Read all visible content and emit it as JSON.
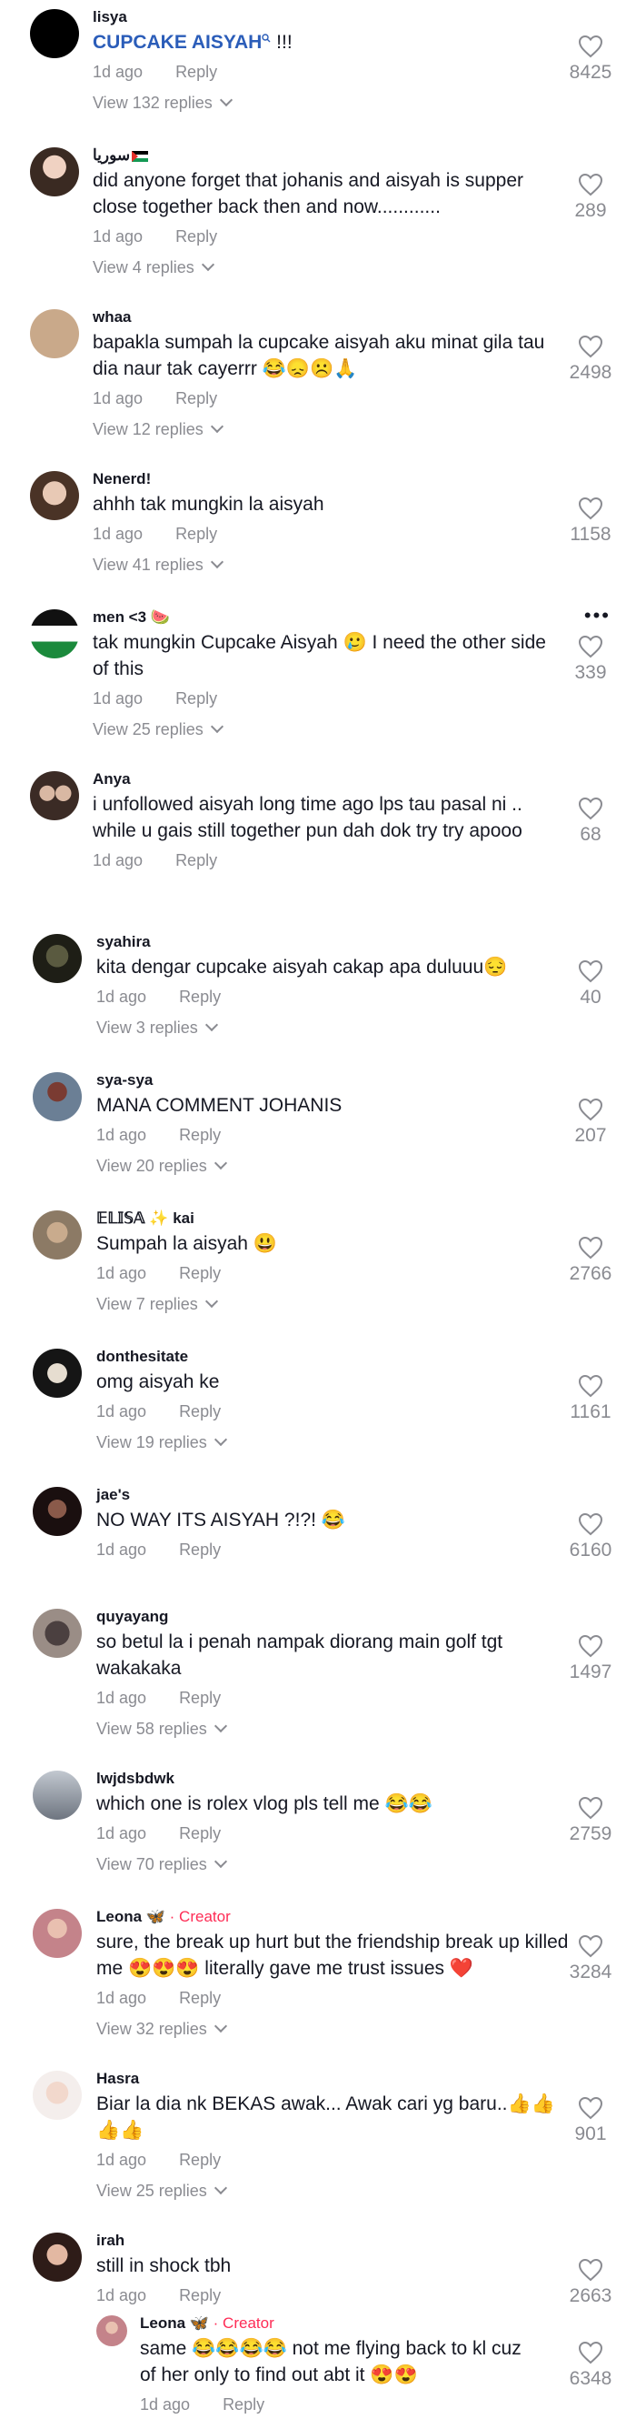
{
  "comments": [
    {
      "user": "lisya",
      "pre": "",
      "hl": "CUPCAKE AISYAH",
      "post": " !!!",
      "when": "1d ago",
      "reply": "Reply",
      "likes": "8425",
      "view": "View 132 replies"
    },
    {
      "user": "سوريا",
      "text": "did anyone forget that johanis and aisyah is supper close together back then and now............",
      "when": "1d ago",
      "reply": "Reply",
      "likes": "289",
      "view": "View 4 replies"
    },
    {
      "user": "whaa",
      "text": "bapakla sumpah la cupcake aisyah aku minat gila tau dia naur tak cayerrr 😂😞☹️🙏",
      "when": "1d ago",
      "reply": "Reply",
      "likes": "2498",
      "view": "View 12 replies"
    },
    {
      "user": "Nenerd!",
      "text": "ahhh tak mungkin la aisyah",
      "when": "1d ago",
      "reply": "Reply",
      "likes": "1158",
      "view": "View 41 replies"
    },
    {
      "user": "men <3 🍉",
      "text": "tak mungkin Cupcake Aisyah 🥲 I need the other side of this",
      "when": "1d ago",
      "reply": "Reply",
      "likes": "339",
      "view": "View 25 replies",
      "more": "•••"
    },
    {
      "user": "Anya",
      "text": "i unfollowed aisyah long time ago lps tau pasal ni .. while u gais still together pun dah dok try try apooo",
      "when": "1d ago",
      "reply": "Reply",
      "likes": "68",
      "view": ""
    },
    {
      "user": "syahira",
      "text": "kita dengar cupcake aisyah cakap apa duluuu😔",
      "when": "1d ago",
      "reply": "Reply",
      "likes": "40",
      "view": "View 3 replies"
    },
    {
      "user": "sya-sya",
      "text": "MANA COMMENT JOHANIS",
      "when": "1d ago",
      "reply": "Reply",
      "likes": "207",
      "view": "View 20 replies"
    },
    {
      "user": "𝔼𝕃𝕀𝕊𝔸 ✨ kai",
      "text": "Sumpah la aisyah 😃",
      "when": "1d ago",
      "reply": "Reply",
      "likes": "2766",
      "view": "View 7 replies"
    },
    {
      "user": "donthesitate",
      "text": "omg aisyah ke",
      "when": "1d ago",
      "reply": "Reply",
      "likes": "1161",
      "view": "View 19 replies"
    },
    {
      "user": "jae's",
      "text": "NO WAY ITS AISYAH ?!?! 😂",
      "when": "1d ago",
      "reply": "Reply",
      "likes": "6160",
      "view": ""
    },
    {
      "user": "quyayang",
      "text": "so betul la i penah nampak diorang main golf tgt wakakaka",
      "when": "1d ago",
      "reply": "Reply",
      "likes": "1497",
      "view": "View 58 replies"
    },
    {
      "user": "lwjdsbdwk",
      "text": "which one is rolex vlog pls tell me 😂😂",
      "when": "1d ago",
      "reply": "Reply",
      "likes": "2759",
      "view": "View 70 replies"
    },
    {
      "user": "Leona 🦋",
      "creator": " · Creator",
      "text": "sure, the break up hurt but the friendship break up killed me 😍😍😍 literally gave me trust issues ❤️",
      "when": "1d ago",
      "reply": "Reply",
      "likes": "3284",
      "view": "View 32 replies"
    },
    {
      "user": "Hasra",
      "text": "Biar la dia nk BEKAS awak... Awak cari yg baru..👍👍👍👍",
      "when": "1d ago",
      "reply": "Reply",
      "likes": "901",
      "view": "View 25 replies"
    },
    {
      "user": "irah",
      "text": "still in shock tbh",
      "when": "1d ago",
      "reply": "Reply",
      "likes": "2663",
      "view": ""
    }
  ],
  "reply": {
    "user": "Leona 🦋",
    "creator": " · Creator",
    "text": "same 😂😂😂😂 not me flying back to kl cuz of her only to find out abt it 😍😍",
    "when": "1d ago",
    "reply": "Reply",
    "likes": "6348"
  },
  "colors": {
    "accent": "#fe2c55",
    "link": "#2b5db9",
    "muted": "#8a8b91"
  }
}
